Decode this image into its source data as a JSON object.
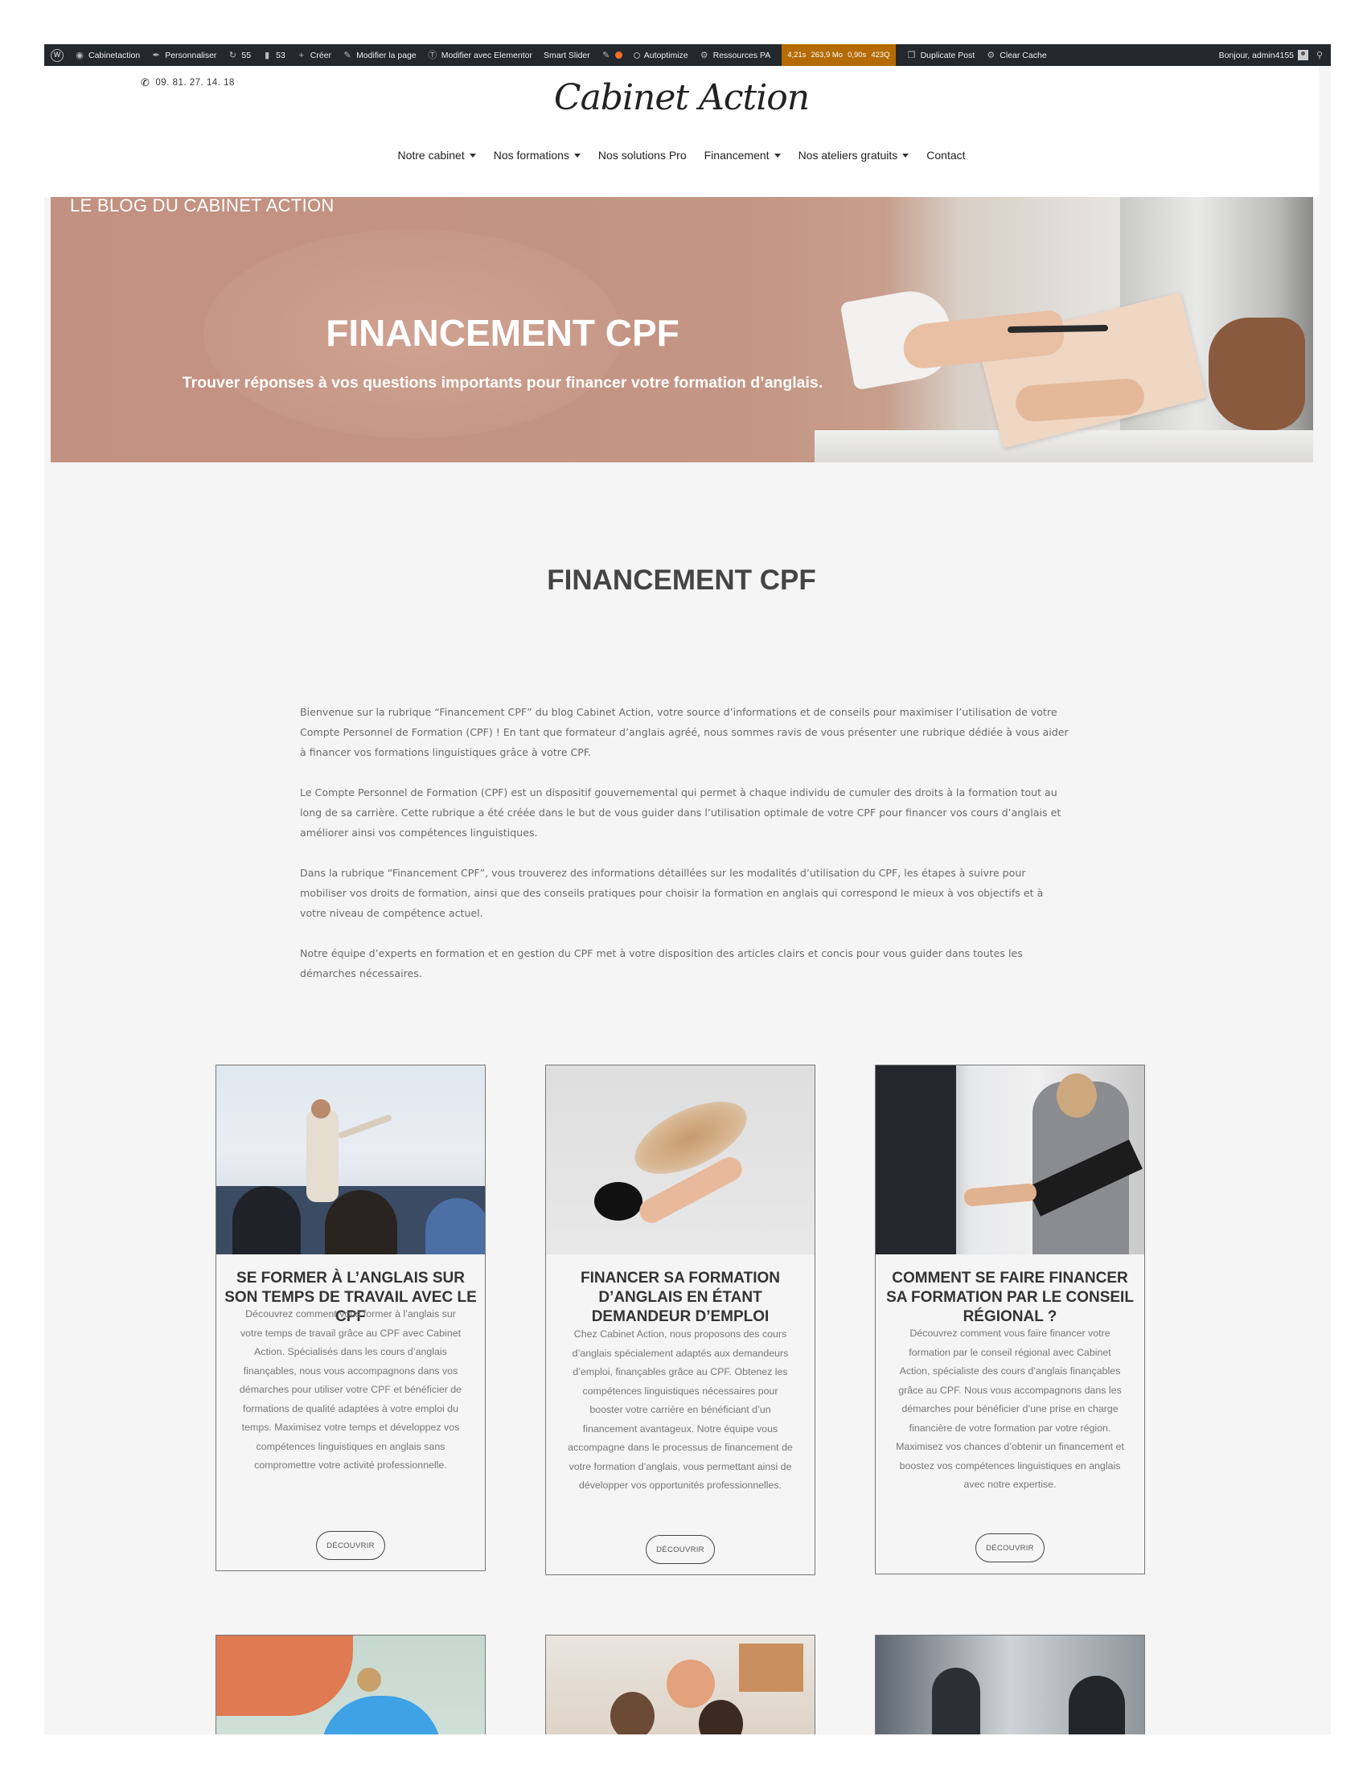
{
  "admin_bar": {
    "site_name": "Cabinetaction",
    "customize": "Personnaliser",
    "updates": "55",
    "comments": "53",
    "new": "Créer",
    "edit_page": "Modifier la page",
    "edit_elementor": "Modifier avec Elementor",
    "smart_slider": "Smart Slider",
    "autoptimize": "Autoptimize",
    "resources": "Ressources PA",
    "qm_stats": [
      "4,21s",
      "263,9 Mo",
      "0,90s",
      "423Q"
    ],
    "duplicate_post": "Duplicate Post",
    "clear_cache": "Clear Cache",
    "greeting": "Bonjour, admin4155"
  },
  "header": {
    "phone": "09. 81. 27. 14. 18",
    "logo": "Cabinet Action",
    "nav": [
      {
        "label": "Notre cabinet",
        "dropdown": true
      },
      {
        "label": "Nos formations",
        "dropdown": true
      },
      {
        "label": "Nos solutions Pro",
        "dropdown": false
      },
      {
        "label": "Financement",
        "dropdown": true
      },
      {
        "label": "Nos ateliers gratuits",
        "dropdown": true
      },
      {
        "label": "Contact",
        "dropdown": false
      }
    ]
  },
  "hero": {
    "blog_label": "LE BLOG DU CABINET ACTION",
    "title": "FINANCEMENT CPF",
    "subtitle": "Trouver réponses à vos questions importants pour financer votre formation d’anglais."
  },
  "main": {
    "title": "FINANCEMENT CPF",
    "paragraphs": [
      "Bienvenue sur la rubrique “Financement CPF” du blog Cabinet Action, votre source d’informations et de conseils pour maximiser l’utilisation de votre Compte Personnel de Formation (CPF) ! En tant que formateur d’anglais agréé, nous sommes ravis de vous présenter une rubrique dédiée à vous aider à financer vos formations linguistiques grâce à votre CPF.",
      "Le Compte Personnel de Formation (CPF) est un dispositif gouvernemental qui permet à chaque individu de cumuler des droits à la formation tout au long de sa carrière. Cette rubrique a été créée dans le but de vous guider dans l’utilisation optimale de votre CPF pour financer vos cours d’anglais et améliorer ainsi vos compétences linguistiques.",
      "Dans la rubrique “Financement CPF”, vous trouverez des informations détaillées sur les modalités d’utilisation du CPF, les étapes à suivre pour mobiliser vos droits de formation, ainsi que des conseils pratiques pour choisir la formation en anglais qui correspond le mieux à vos objectifs et à votre niveau de compétence actuel.",
      "Notre équipe d’experts en formation et en gestion du CPF met à votre disposition des articles clairs et concis pour vous guider dans toutes les démarches nécessaires."
    ]
  },
  "cards": [
    {
      "title": "SE FORMER À L’ANGLAIS SUR SON TEMPS DE TRAVAIL AVEC LE CPF",
      "text": "Découvrez comment vous former à l’anglais sur votre temps de travail grâce au CPF avec Cabinet Action. Spécialisés dans les cours d’anglais finançables, nous vous accompagnons dans vos démarches pour utiliser votre CPF et bénéficier de formations de qualité adaptées à votre emploi du temps. Maximisez votre temps et développez vos compétences linguistiques en anglais sans compromettre votre activité professionnelle.",
      "button": "DÉCOUVRIR"
    },
    {
      "title": "FINANCER SA FORMATION D’ANGLAIS EN ÉTANT DEMANDEUR D’EMPLOI",
      "text": "Chez Cabinet Action, nous proposons des cours d’anglais spécialement adaptés aux demandeurs d’emploi, finançables grâce au CPF. Obtenez les compétences linguistiques nécessaires pour booster votre carrière en bénéficiant d’un financement avantageux. Notre équipe vous accompagne dans le processus de financement de votre formation d’anglais, vous permettant ainsi de développer vos opportunités professionnelles.",
      "button": "DÉCOUVRIR"
    },
    {
      "title": "COMMENT SE FAIRE FINANCER SA FORMATION PAR LE CONSEIL RÉGIONAL ?",
      "text": "Découvrez comment vous faire financer votre formation par le conseil régional avec Cabinet Action, spécialiste des cours d’anglais finançables grâce au CPF. Nous vous accompagnons dans les démarches pour bénéficier d’une prise en charge financière de votre formation par votre région. Maximisez vos chances d’obtenir un financement et boostez vos compétences linguistiques en anglais avec notre expertise.",
      "button": "DÉCOUVRIR"
    }
  ]
}
